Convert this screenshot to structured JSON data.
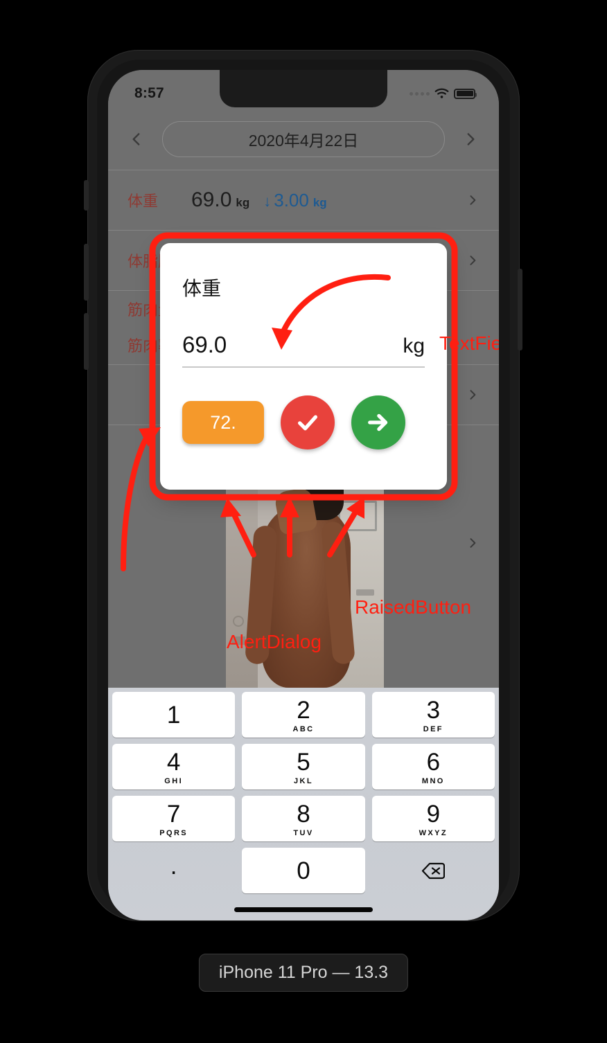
{
  "device": {
    "caption": "iPhone 11 Pro — 13.3"
  },
  "statusbar": {
    "time": "8:57",
    "wifi_icon": "wifi-icon",
    "battery_icon": "battery-full-icon",
    "signal_icon": "signal-dots-icon"
  },
  "app": {
    "date_nav": {
      "prev_icon": "chevron-left-icon",
      "date": "2020年4月22日",
      "next_icon": "chevron-right-icon"
    },
    "rows": [
      {
        "label": "体重",
        "value": "69.0",
        "unit": "kg",
        "delta_arrow": "↓",
        "delta_value": "3.00",
        "delta_unit": "kg",
        "chevron": "chevron-right-icon"
      },
      {
        "label": "体脂肪率",
        "value": "",
        "unit": "",
        "chevron": "chevron-right-icon"
      },
      {
        "label": "筋肉量",
        "value": "",
        "unit": "",
        "chevron": "chevron-right-icon"
      },
      {
        "label": "筋肉率",
        "value": "",
        "unit": "",
        "chevron": "chevron-right-icon"
      },
      {
        "label": "",
        "value": "",
        "unit": "",
        "chevron": "chevron-right-icon"
      },
      {
        "label": "",
        "value": "",
        "unit": "",
        "chevron": "chevron-right-icon"
      }
    ]
  },
  "dialog": {
    "title": "体重",
    "field": {
      "value": "69.0",
      "unit": "kg"
    },
    "buttons": {
      "suggest_label": "72.",
      "confirm_icon": "check-icon",
      "next_icon": "arrow-right-icon"
    }
  },
  "keyboard": {
    "rows": [
      [
        {
          "num": "1",
          "sub": ""
        },
        {
          "num": "2",
          "sub": "ABC"
        },
        {
          "num": "3",
          "sub": "DEF"
        }
      ],
      [
        {
          "num": "4",
          "sub": "GHI"
        },
        {
          "num": "5",
          "sub": "JKL"
        },
        {
          "num": "6",
          "sub": "MNO"
        }
      ],
      [
        {
          "num": "7",
          "sub": "PQRS"
        },
        {
          "num": "8",
          "sub": "TUV"
        },
        {
          "num": "9",
          "sub": "WXYZ"
        }
      ]
    ],
    "bottom": {
      "decimal": ".",
      "zero": "0",
      "backspace_icon": "backspace-icon"
    }
  },
  "annotations": {
    "textfield": "TextField",
    "raised_button": "RaisedButton",
    "alert_dialog": "AlertDialog"
  },
  "colors": {
    "annotation_red": "#ff1f11",
    "button_orange": "#f5992b",
    "button_red": "#e8423c",
    "button_green": "#34a246",
    "delta_blue": "#1d5a92",
    "row_label_red": "#8f3a33"
  }
}
